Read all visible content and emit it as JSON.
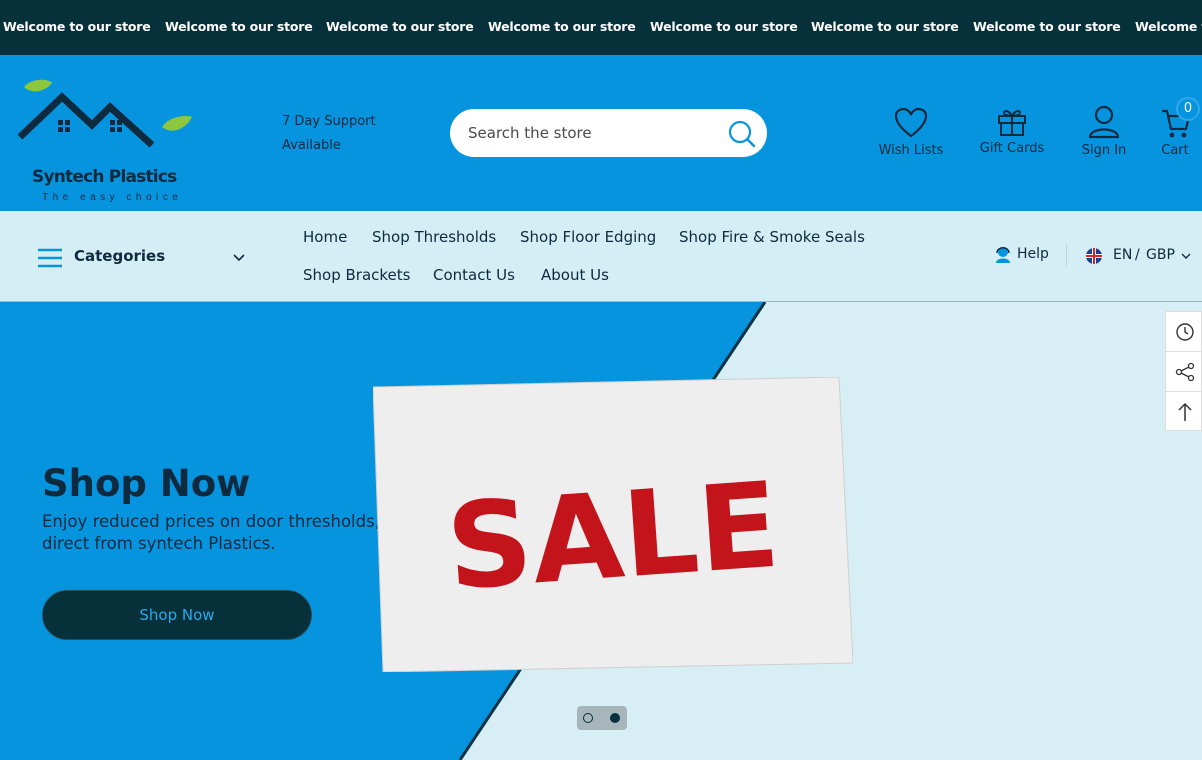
{
  "announcement": {
    "items": [
      "Welcome to our store",
      "Welcome to our store",
      "Welcome to our store",
      "Welcome to our store",
      "Welcome to our store",
      "Welcome to our store",
      "Welcome to our store",
      "Welcome t"
    ]
  },
  "header": {
    "logo": {
      "name": "Syntech Plastics",
      "tagline": "The easy choice",
      "icon": "house-leaf-logo"
    },
    "support_line1": "7 Day Support",
    "support_line2": "Available",
    "search": {
      "placeholder": "Search the store",
      "icon": "search-icon"
    },
    "actions": [
      {
        "label": "Wish Lists",
        "icon": "heart-icon"
      },
      {
        "label": "Gift Cards",
        "icon": "gift-icon"
      },
      {
        "label": "Sign In",
        "icon": "user-icon"
      },
      {
        "label": "Cart",
        "icon": "cart-icon"
      }
    ],
    "cart_count": "0"
  },
  "nav": {
    "categories_label": "Categories",
    "links": [
      "Home",
      "Shop Thresholds",
      "Shop Floor Edging",
      "Shop Fire & Smoke Seals",
      "Shop Brackets",
      "Contact Us",
      "About Us"
    ],
    "help_label": "Help",
    "language": "EN",
    "separator": "/",
    "currency": "GBP"
  },
  "hero": {
    "title": "Shop Now",
    "subtitle": "Enjoy reduced prices on door thresholds, Buy direct from syntech Plastics.",
    "button_label": "Shop Now",
    "sale_text": "SALE",
    "slides_count": 2,
    "active_slide": 2
  },
  "side_tools": [
    "history-icon",
    "share-icon",
    "arrow-up-icon"
  ],
  "colors": {
    "announce_bg": "#06303a",
    "header_bg": "#0794de",
    "nav_bg": "#d5eef5",
    "text_dark": "#0d2a3e",
    "button_bg": "#06303a",
    "button_text": "#2ea8ea",
    "sale_red": "#c3141b"
  }
}
